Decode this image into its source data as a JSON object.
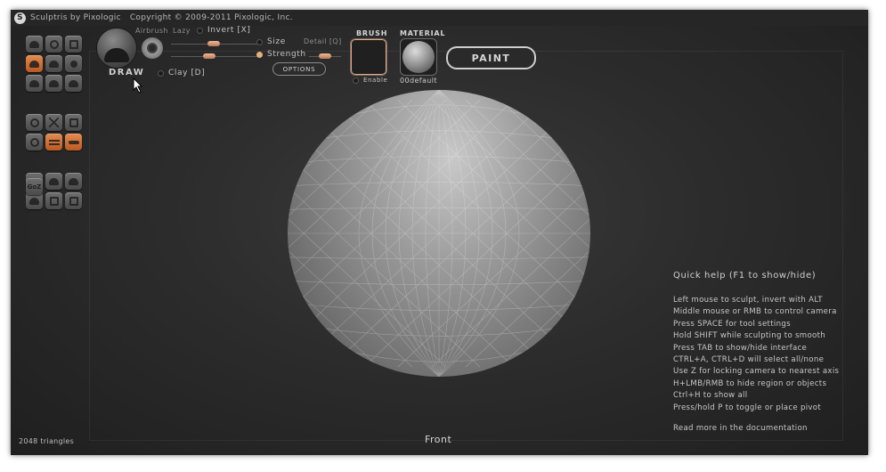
{
  "window": {
    "title": "Sculptris by Pixologic",
    "copyright": "Copyright © 2009-2011 Pixologic, Inc."
  },
  "toolbar": {
    "tool_icons": [
      "draw-icon",
      "rotate-icon",
      "scale-icon",
      "crease-icon",
      "inflate-icon",
      "grab-icon",
      "flatten-icon",
      "pinch-icon",
      "smooth-icon",
      "reduce-icon",
      "mask-icon",
      "grid-icon",
      "symmetry-icon",
      "wireframe-icon",
      "pivot-icon",
      "sphere-icon",
      "import-icon",
      "export-icon",
      "new-icon",
      "open-icon",
      "save-icon"
    ],
    "goz_label": "GoZ"
  },
  "brush_options": {
    "tool_name": "DRAW",
    "airbrush_label": "Airbrush",
    "lazy_label": "Lazy",
    "invert_label": "Invert [X]",
    "size_label": "Size",
    "detail_label": "Detail [Q]",
    "strength_label": "Strength",
    "clay_label": "Clay [D]",
    "options_label": "OPTIONS"
  },
  "brush_panel": {
    "title": "BRUSH",
    "enable_label": "Enable"
  },
  "material_panel": {
    "title": "MATERIAL",
    "name": "00default"
  },
  "paint_button": {
    "label": "PAINT"
  },
  "quick_help": {
    "title": "Quick help (F1 to show/hide)",
    "lines": [
      "Left mouse to sculpt, invert with ALT",
      "Middle mouse or RMB to control camera",
      "Press SPACE for tool settings",
      "Hold SHIFT while sculpting to smooth",
      "Press TAB to show/hide interface",
      "CTRL+A, CTRL+D will select all/none",
      "Use Z for locking camera to nearest axis",
      "H+LMB/RMB to hide region or objects",
      "Ctrl+H to show all",
      "Press/hold P to toggle or place pivot"
    ],
    "more": "Read more in the documentation"
  },
  "status": {
    "triangles": "2048 triangles",
    "view": "Front"
  },
  "colors": {
    "accent_orange": "#d9743a",
    "background": "#2c2c2c"
  }
}
